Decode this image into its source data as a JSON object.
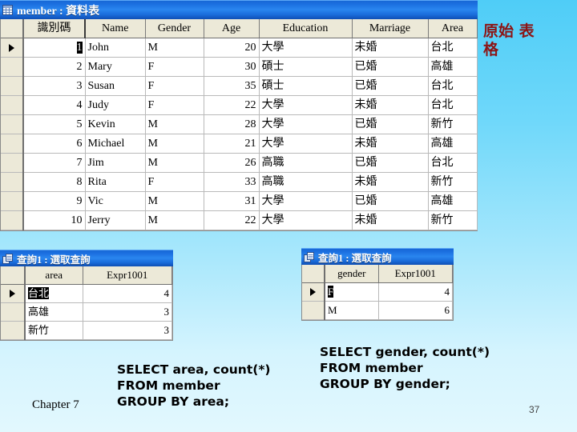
{
  "background": {
    "top_color": "#4fcdf7",
    "bottom_color": "#e2f8fe"
  },
  "member_window": {
    "icon": "table-grid-icon",
    "title": "member : 資料表",
    "columns": [
      "識別碼",
      "Name",
      "Gender",
      "Age",
      "Education",
      "Marriage",
      "Area"
    ],
    "rows": [
      {
        "id": "1",
        "name": "John",
        "gender": "M",
        "age": "20",
        "education": "大學",
        "marriage": "未婚",
        "area": "台北",
        "current": true
      },
      {
        "id": "2",
        "name": "Mary",
        "gender": "F",
        "age": "30",
        "education": "碩士",
        "marriage": "已婚",
        "area": "高雄",
        "current": false
      },
      {
        "id": "3",
        "name": "Susan",
        "gender": "F",
        "age": "35",
        "education": "碩士",
        "marriage": "已婚",
        "area": "台北",
        "current": false
      },
      {
        "id": "4",
        "name": "Judy",
        "gender": "F",
        "age": "22",
        "education": "大學",
        "marriage": "未婚",
        "area": "台北",
        "current": false
      },
      {
        "id": "5",
        "name": "Kevin",
        "gender": "M",
        "age": "28",
        "education": "大學",
        "marriage": "已婚",
        "area": "新竹",
        "current": false
      },
      {
        "id": "6",
        "name": "Michael",
        "gender": "M",
        "age": "21",
        "education": "大學",
        "marriage": "未婚",
        "area": "高雄",
        "current": false
      },
      {
        "id": "7",
        "name": "Jim",
        "gender": "M",
        "age": "26",
        "education": "高職",
        "marriage": "已婚",
        "area": "台北",
        "current": false
      },
      {
        "id": "8",
        "name": "Rita",
        "gender": "F",
        "age": "33",
        "education": "高職",
        "marriage": "未婚",
        "area": "新竹",
        "current": false
      },
      {
        "id": "9",
        "name": "Vic",
        "gender": "M",
        "age": "31",
        "education": "大學",
        "marriage": "已婚",
        "area": "高雄",
        "current": false
      },
      {
        "id": "10",
        "name": "Jerry",
        "gender": "M",
        "age": "22",
        "education": "大學",
        "marriage": "未婚",
        "area": "新竹",
        "current": false
      }
    ]
  },
  "query_area_window": {
    "icon": "query-window-icon",
    "title": "查詢1 : 選取查詢",
    "columns": [
      "area",
      "Expr1001"
    ],
    "rows": [
      {
        "key": "台北",
        "count": "4",
        "current": true
      },
      {
        "key": "高雄",
        "count": "3",
        "current": false
      },
      {
        "key": "新竹",
        "count": "3",
        "current": false
      }
    ]
  },
  "query_gender_window": {
    "icon": "query-window-icon",
    "title": "查詢1 : 選取查詢",
    "columns": [
      "gender",
      "Expr1001"
    ],
    "rows": [
      {
        "key": "F",
        "count": "4",
        "current": true
      },
      {
        "key": "M",
        "count": "6",
        "current": false
      }
    ]
  },
  "annotations": {
    "original_table_label": "原始\n表格",
    "original_table_color": "#8c1515",
    "sql_area": "SELECT area, count(*)\nFROM member\nGROUP BY area;",
    "sql_gender": "SELECT gender, count(*)\nFROM member\nGROUP BY gender;"
  },
  "footer": {
    "chapter": "Chapter 7",
    "page_number": "37"
  }
}
